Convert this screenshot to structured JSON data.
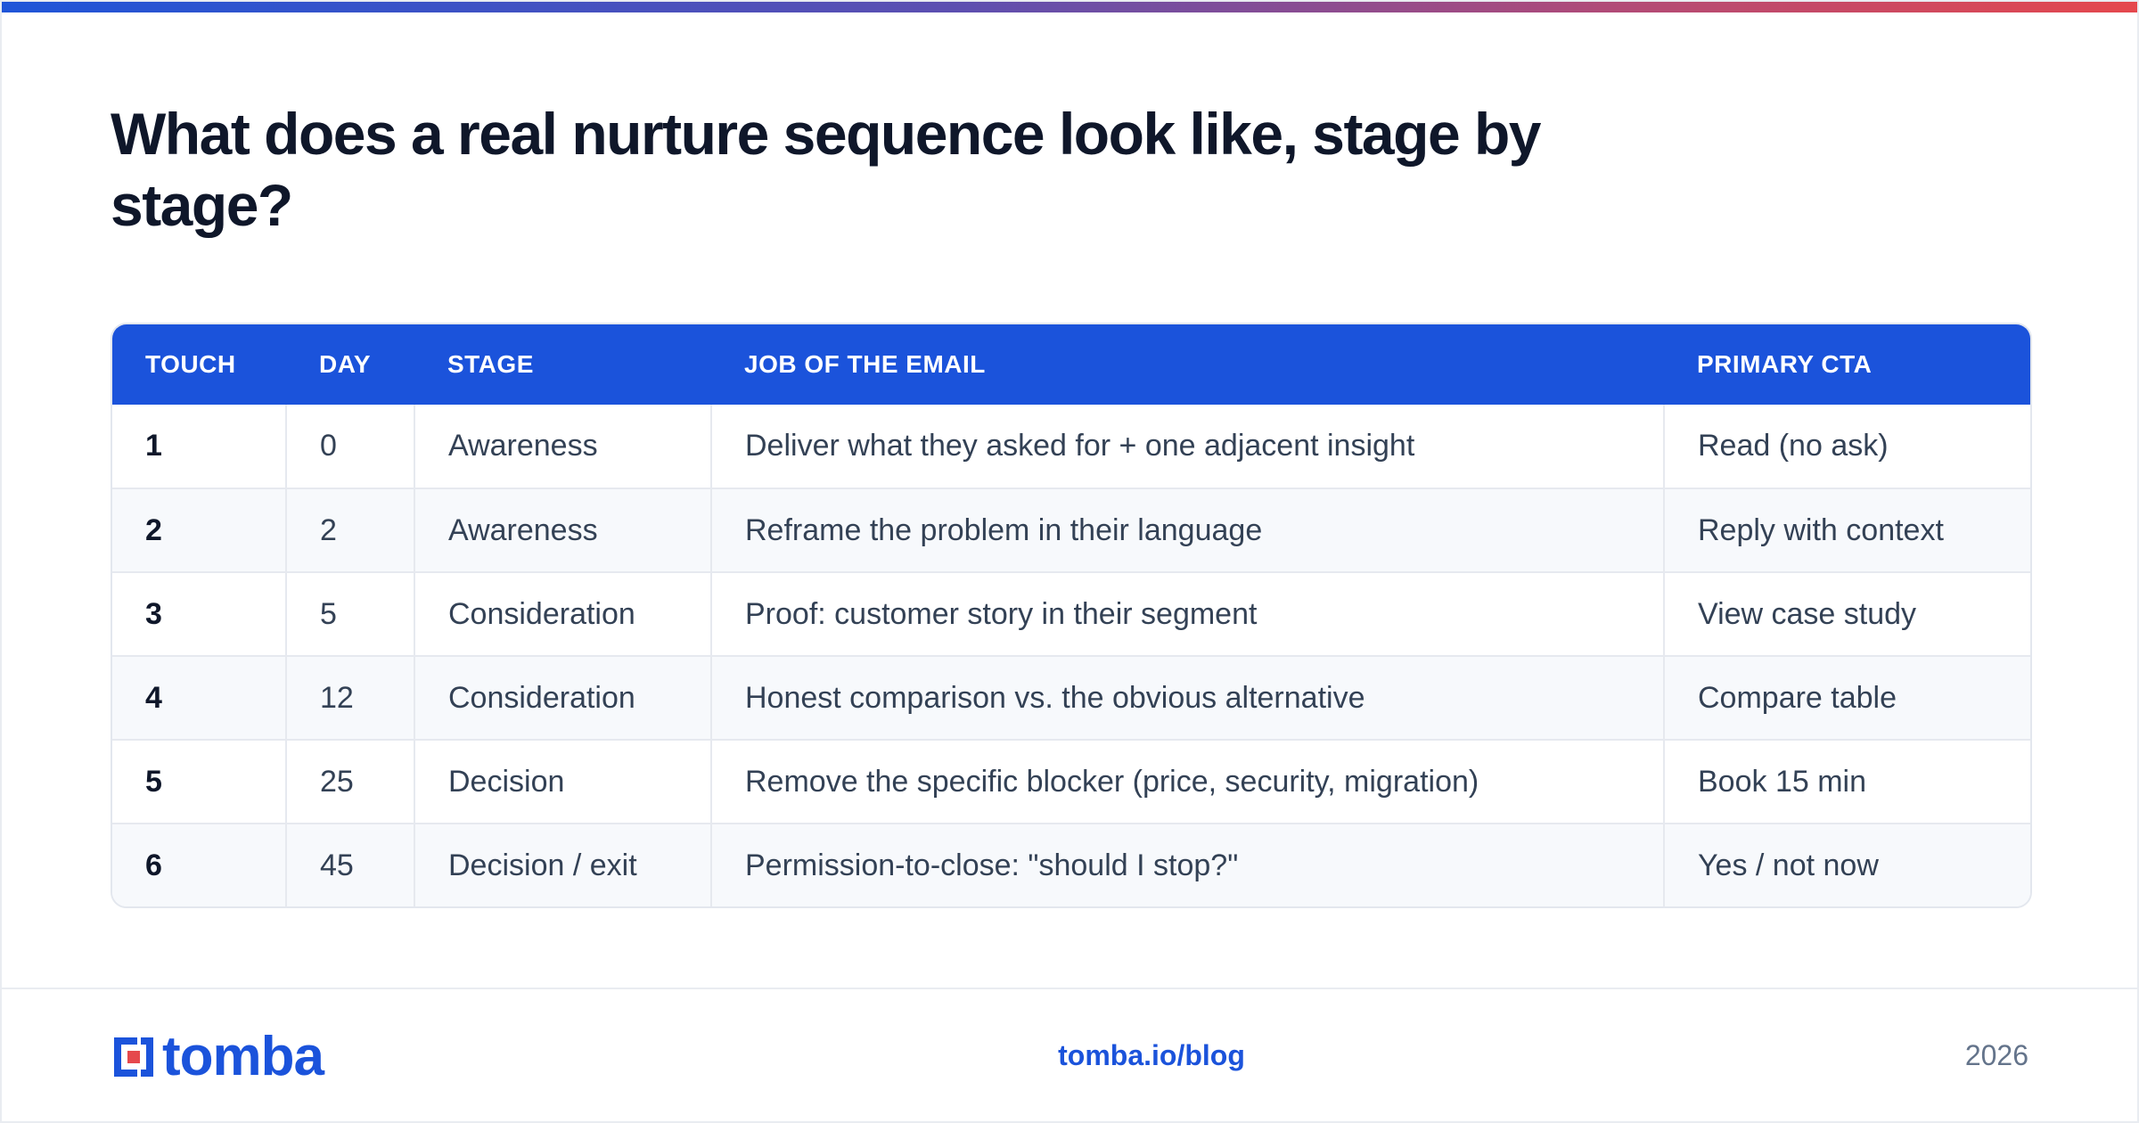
{
  "title": "What does a real nurture sequence look like, stage by stage?",
  "table": {
    "headers": [
      "TOUCH",
      "DAY",
      "STAGE",
      "JOB OF THE EMAIL",
      "PRIMARY CTA"
    ],
    "rows": [
      [
        "1",
        "0",
        "Awareness",
        "Deliver what they asked for + one adjacent insight",
        "Read (no ask)"
      ],
      [
        "2",
        "2",
        "Awareness",
        "Reframe the problem in their language",
        "Reply with context"
      ],
      [
        "3",
        "5",
        "Consideration",
        "Proof: customer story in their segment",
        "View case study"
      ],
      [
        "4",
        "12",
        "Consideration",
        "Honest comparison vs. the obvious alternative",
        "Compare table"
      ],
      [
        "5",
        "25",
        "Decision",
        "Remove the specific blocker (price, security, migration)",
        "Book 15 min"
      ],
      [
        "6",
        "45",
        "Decision / exit",
        "Permission-to-close: \"should I stop?\"",
        "Yes / not now"
      ]
    ]
  },
  "footer": {
    "brand": "tomba",
    "link": "tomba.io/blog",
    "year": "2026"
  },
  "colors": {
    "accent": "#1b53db",
    "title": "#0f172a",
    "body_text": "#334155",
    "logo_red": "#e5484d"
  },
  "icons": {
    "logo": "tomba-logo-icon"
  }
}
